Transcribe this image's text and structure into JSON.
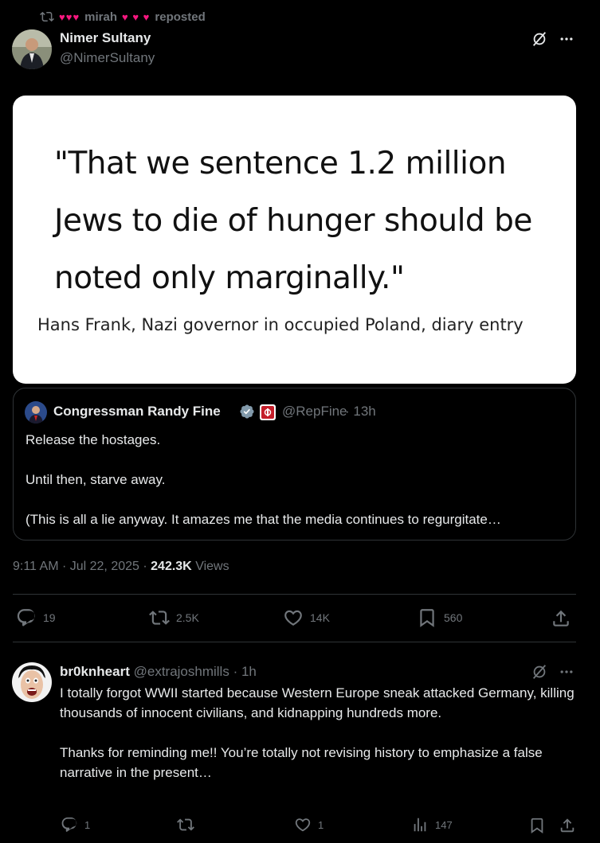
{
  "repost": {
    "hearts_left": "♥♥♥",
    "user": "mirah",
    "hearts_right": "♥ ♥ ♥",
    "label": "reposted"
  },
  "tweet": {
    "author_name": "Nimer Sultany",
    "author_handle": "@NimerSultany",
    "image": {
      "quote": "\"That we sentence 1.2 million Jews to die of hunger should be noted only marginally.\"",
      "attribution": "Hans Frank, Nazi governor in occupied Poland, diary entry"
    },
    "quoted": {
      "name": "Congressman Randy Fine",
      "handle": "@RepFine",
      "time": "· 13h",
      "text": "Release the hostages.\n\nUntil then, starve away.\n\n(This is all a lie anyway.  It amazes me that the media continues to regurgitate…"
    },
    "time": "9:11 AM · Jul 22, 2025 ·",
    "views_count": "242.3K",
    "views_label": "Views",
    "stats": {
      "replies": "19",
      "reposts": "2.5K",
      "likes": "14K",
      "bookmarks": "560"
    }
  },
  "reply": {
    "author_name": "br0knheart",
    "author_handle": "@extrajoshmills",
    "time": "· 1h",
    "text": "I totally forgot WWII started because Western Europe sneak attacked Germany, killing thousands of innocent civilians, and kidnapping hundreds more.\n\nThanks for reminding me!!  You’re totally not revising history to emphasize a false narrative in the present…",
    "stats": {
      "replies": "1",
      "reposts": "",
      "likes": "1",
      "views": "147"
    }
  },
  "colors": {
    "background": "#000000",
    "text": "#e7e9ea",
    "muted": "#71767b",
    "border": "#2f3336",
    "heart_accent": "#f91880",
    "verified": "#829aab"
  }
}
